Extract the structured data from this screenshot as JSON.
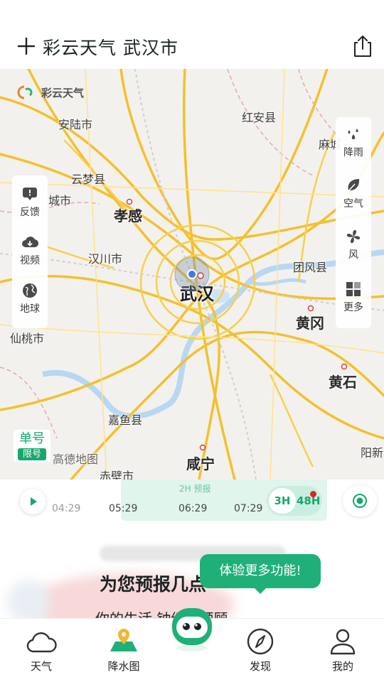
{
  "header": {
    "title": "彩云天气  武汉市",
    "add_icon": "plus-icon",
    "share_icon": "share-icon"
  },
  "map": {
    "logo_text": "彩云天气",
    "watermark": "高德地图",
    "places": {
      "anlu": "安陆市",
      "hongan": "红安县",
      "macheng": "麻城",
      "yunmeng": "云梦县",
      "yingcheng": "城市",
      "xiaogan": "孝感",
      "hanchuan": "汉川市",
      "tuanfeng": "团风县",
      "wuhan": "武汉",
      "huanggang": "黄冈",
      "xiantao": "仙桃市",
      "huangshi": "黄石",
      "jiayu": "嘉鱼县",
      "xianning": "咸宁",
      "chibi": "赤壁市",
      "yangxin": "阳新"
    },
    "left_tools": [
      {
        "label": "反馈",
        "icon": "feedback-icon"
      },
      {
        "label": "视频",
        "icon": "video-download-icon"
      },
      {
        "label": "地球",
        "icon": "globe-icon"
      }
    ],
    "right_tools": [
      {
        "label": "降雨",
        "icon": "rain-drops-icon"
      },
      {
        "label": "空气",
        "icon": "leaf-icon"
      },
      {
        "label": "风",
        "icon": "wind-fan-icon"
      },
      {
        "label": "更多",
        "icon": "grid-more-icon"
      }
    ],
    "traffic_limit": {
      "line1": "单号",
      "line2": "限号"
    }
  },
  "timeline": {
    "forecast_label": "2H 预报",
    "ticks": [
      "04:29",
      "05:29",
      "06:29",
      "07:29"
    ],
    "range_options": [
      "3H",
      "48H"
    ],
    "active_range": "3H",
    "colors": {
      "accent": "#17a86b",
      "band": "#e0f5ec"
    }
  },
  "promo": {
    "headline": "为您预报几点",
    "subline": "你的生活     钟级的预顾",
    "tooltip": "体验更多功能!"
  },
  "bottom_nav": [
    {
      "label": "天气",
      "icon": "cloud-icon",
      "active": false
    },
    {
      "label": "降水图",
      "icon": "map-pin-icon",
      "active": true
    },
    {
      "label": "发现",
      "icon": "compass-icon",
      "active": false
    },
    {
      "label": "我的",
      "icon": "user-icon",
      "active": false
    }
  ]
}
